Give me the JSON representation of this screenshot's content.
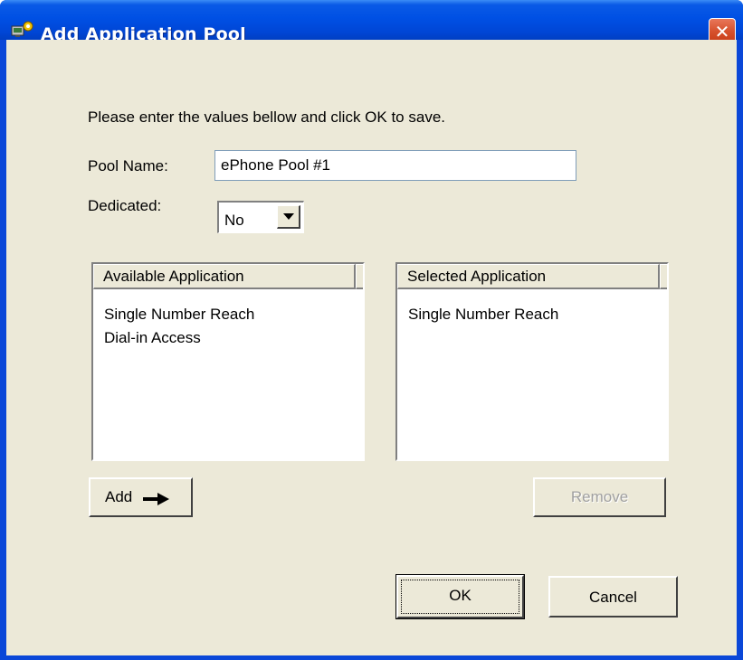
{
  "window": {
    "title": "Add Application Pool",
    "icon": "application-pool-icon",
    "close_icon": "close-icon"
  },
  "form": {
    "instruction": "Please enter the values  bellow and click OK to  save.",
    "pool_name_label": "Pool Name:",
    "pool_name_value": "ePhone Pool #1",
    "dedicated_label": "Dedicated:",
    "dedicated_value": "No"
  },
  "available_list": {
    "header": "Available Application",
    "items": [
      "Single Number Reach",
      "Dial-in Access"
    ]
  },
  "selected_list": {
    "header": "Selected Application",
    "items": [
      "Single Number Reach"
    ]
  },
  "buttons": {
    "add": "Add",
    "add_icon": "right-arrow-icon",
    "remove": "Remove",
    "ok": "OK",
    "cancel": "Cancel"
  },
  "colors": {
    "titlebar": "#0050e4",
    "dialog_bg": "#ece9d8",
    "close_button": "#d6502c",
    "disabled_text": "#a0a0a0"
  }
}
